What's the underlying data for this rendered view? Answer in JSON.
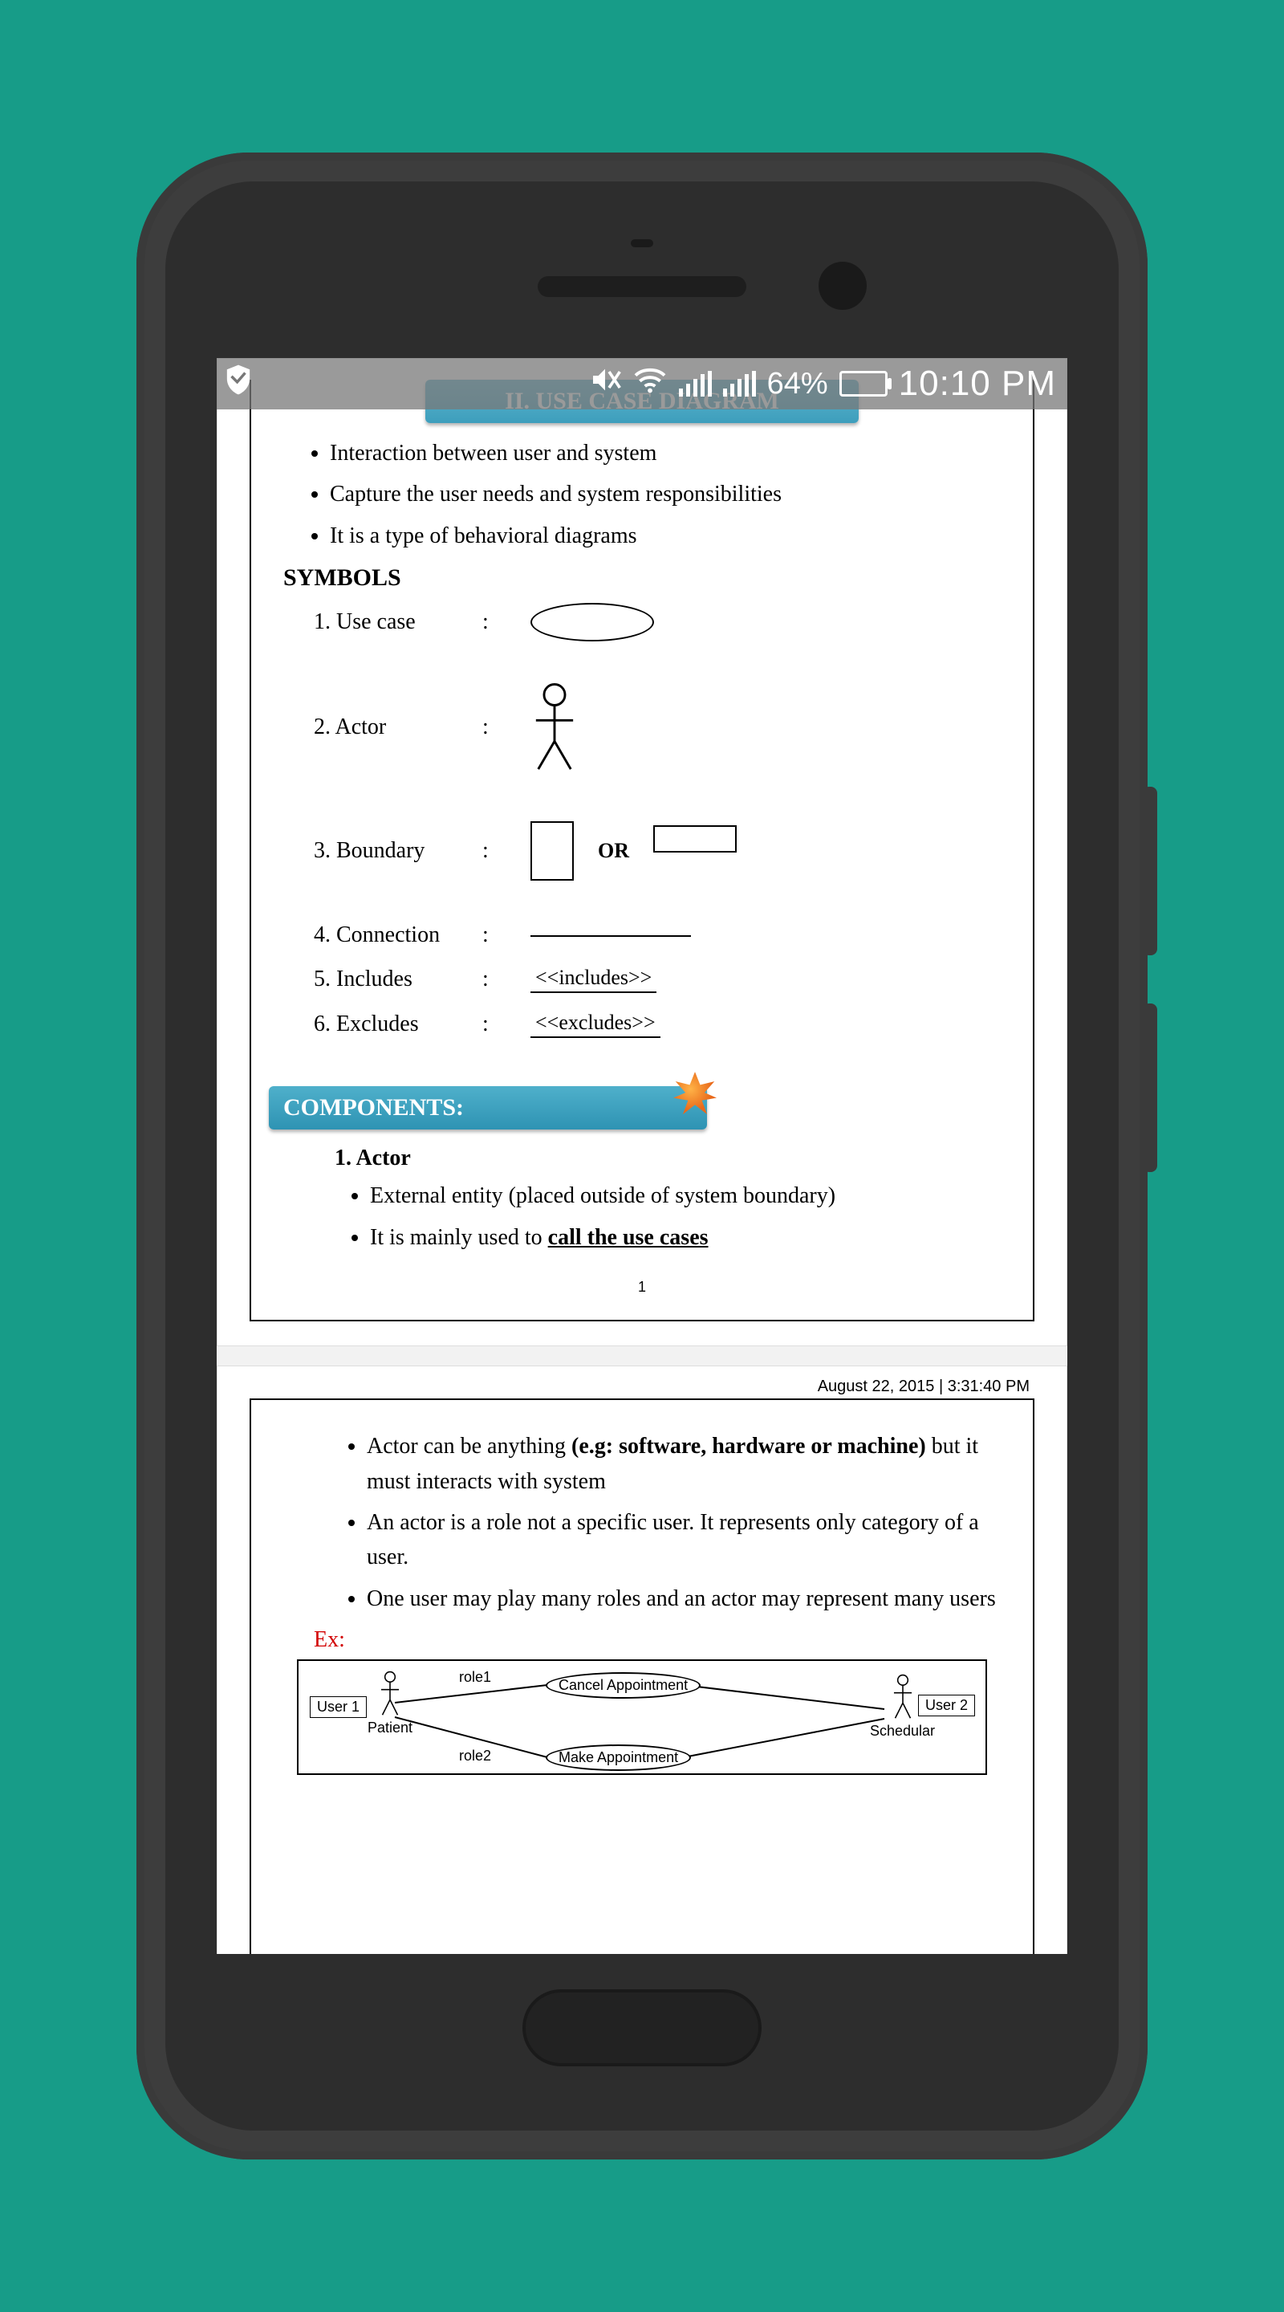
{
  "status": {
    "battery_pct": "64%",
    "time": "10:10 PM"
  },
  "page1": {
    "heading": "II. USE CASE DIAGRAM",
    "bullets": [
      "Interaction between user and system",
      "Capture the user needs and system responsibilities",
      "It is a type of behavioral diagrams"
    ],
    "symbols_heading": "SYMBOLS",
    "symbols": {
      "s1": "Use case",
      "s2": "Actor",
      "s3": "Boundary",
      "s3_or": "OR",
      "s4": "Connection",
      "s5": "Includes",
      "s5_val": "<<includes>>",
      "s6": "Excludes",
      "s6_val": "<<excludes>>"
    },
    "components_heading": "COMPONENTS:",
    "components": {
      "item1_title": "1.  Actor",
      "item1_b1": "External entity (placed outside of system boundary)",
      "item1_b2_pre": "It is mainly used to ",
      "item1_b2_em": "call the use cases"
    },
    "page_num": "1"
  },
  "page2": {
    "timestamp": "August 22, 2015 | 3:31:40 PM",
    "bullets": {
      "b1_pre": "Actor can be anything ",
      "b1_bold": "(e.g: software, hardware or machine)",
      "b1_post": " but it must interacts with system",
      "b2": "An actor is a role not a specific user. It represents only category of a user.",
      "b3": "One user may play many roles and an actor may represent many users"
    },
    "ex_label": "Ex:",
    "diagram": {
      "user1": "User 1",
      "user2": "User 2",
      "patient": "Patient",
      "schedular": "Schedular",
      "role1": "role1",
      "role2": "role2",
      "uc_cancel": "Cancel Appointment",
      "uc_make": "Make Appointment"
    }
  }
}
